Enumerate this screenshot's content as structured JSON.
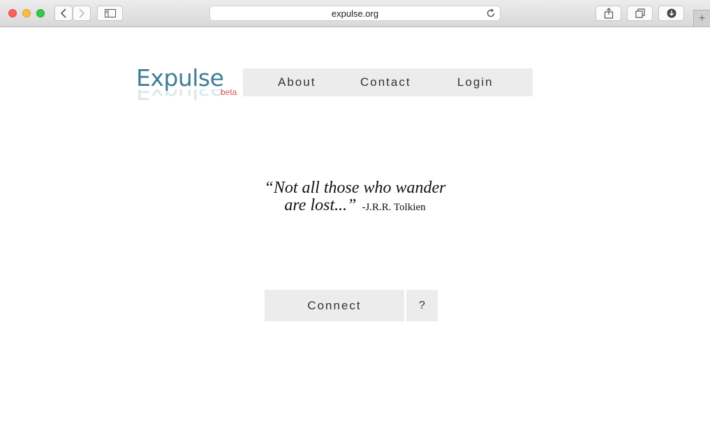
{
  "browser": {
    "url": "expulse.org",
    "new_tab_symbol": "+",
    "icons": {
      "back": "chevron-left-icon",
      "forward": "chevron-right-icon",
      "sidebar": "sidebar-icon",
      "reload": "reload-icon",
      "share": "share-icon",
      "tabs": "tabs-icon",
      "downloads": "download-icon"
    },
    "traffic_light_colors": {
      "close": "#fc605c",
      "minimize": "#fdbc40",
      "zoom": "#34c84a"
    }
  },
  "logo": {
    "name": "Expulse",
    "badge": "beta",
    "name_color": "#3f7e95",
    "badge_color": "#d9534f"
  },
  "nav": {
    "items": [
      "About",
      "Contact",
      "Login"
    ]
  },
  "quote": {
    "line1": "“Not all those who wander",
    "line2": "are lost...”",
    "author": "-J.R.R.  Tolkien"
  },
  "actions": {
    "connect_label": "Connect",
    "help_label": "?"
  }
}
